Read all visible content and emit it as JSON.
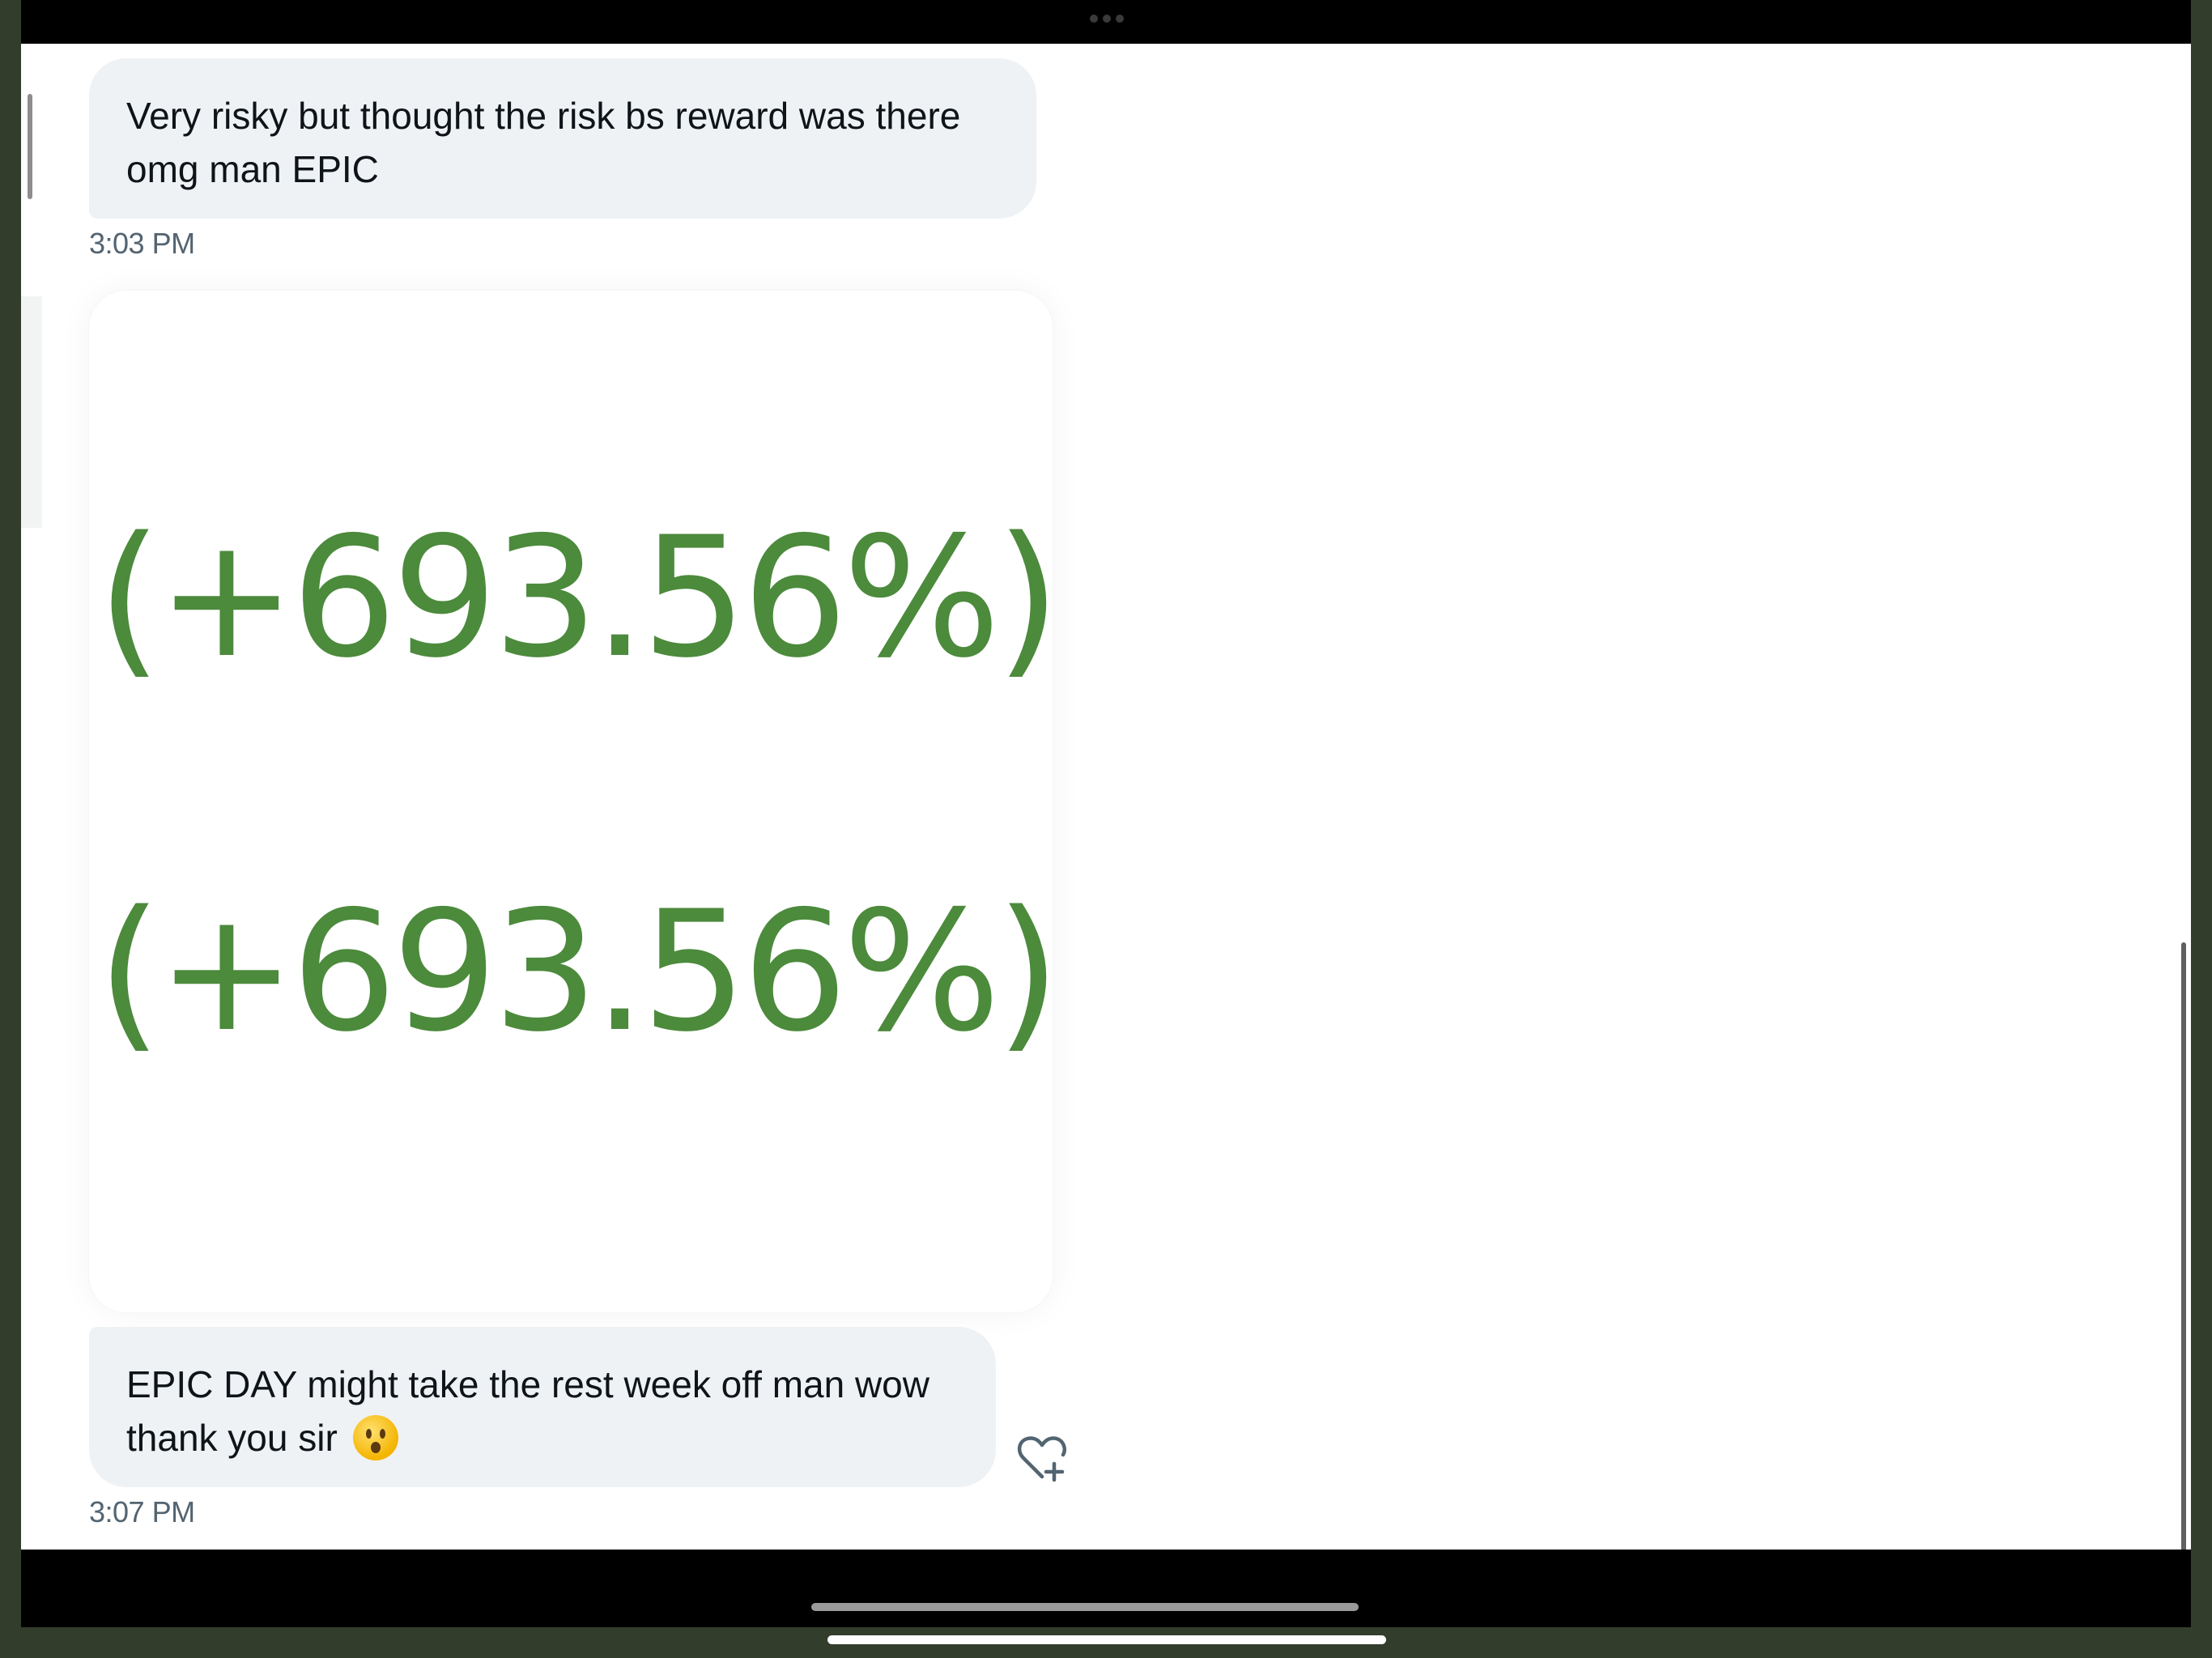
{
  "messages": [
    {
      "text": "Very risky but thought the risk bs reward was there\nomg man EPIC",
      "time": "3:03 PM"
    },
    {
      "type": "image",
      "image_lines": [
        "(+693.56%)",
        "(+693.56%)"
      ],
      "text_color": "#4c8a3c"
    },
    {
      "text": "EPIC DAY might take the rest week off man wow\nthank you sir",
      "emoji": "astonished-face-emoji",
      "time": "3:07 PM"
    }
  ],
  "icons": {
    "react": "heart-plus-icon",
    "multitask": "three-dots-icon"
  },
  "colors": {
    "bubble_bg": "#eff2f4",
    "timestamp": "#536471",
    "gain_green": "#4c8a3c",
    "device_bezel": "#333d2c"
  }
}
